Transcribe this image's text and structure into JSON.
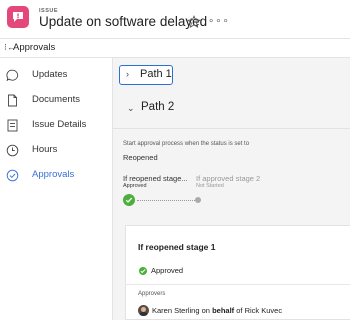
{
  "header": {
    "tag": "ISSUE",
    "title": "Update on software delayed",
    "more_label": "∘∘∘"
  },
  "back": {
    "label": "Approvals",
    "icon": "collapse-left-icon"
  },
  "sidebar": {
    "items": [
      {
        "label": "Updates",
        "icon": "chat-bubble-icon",
        "active": false
      },
      {
        "label": "Documents",
        "icon": "document-icon",
        "active": false
      },
      {
        "label": "Issue Details",
        "icon": "details-list-icon",
        "active": false
      },
      {
        "label": "Hours",
        "icon": "clock-icon",
        "active": false
      },
      {
        "label": "Approvals",
        "icon": "check-circle-icon",
        "active": true
      }
    ]
  },
  "paths": {
    "path1": {
      "label": "Path 1"
    },
    "path2": {
      "label": "Path 2",
      "status_prompt": "Start approval process when the status is set to",
      "status_value": "Reopened",
      "stages": [
        {
          "name": "If reopened stage...",
          "state": "Approved"
        },
        {
          "name": "If approved stage 2",
          "state": "Not Started"
        }
      ]
    }
  },
  "card": {
    "title": "If reopened stage 1",
    "status": "Approved",
    "approvers_label": "Approvers",
    "approver": {
      "name": "Karen Sterling",
      "on": "on",
      "behalf": "behalf",
      "of": "of Rick Kuvec"
    }
  },
  "colors": {
    "brand": "#e4477a",
    "accent": "#3a6fd8",
    "approved": "#4caf3c"
  }
}
